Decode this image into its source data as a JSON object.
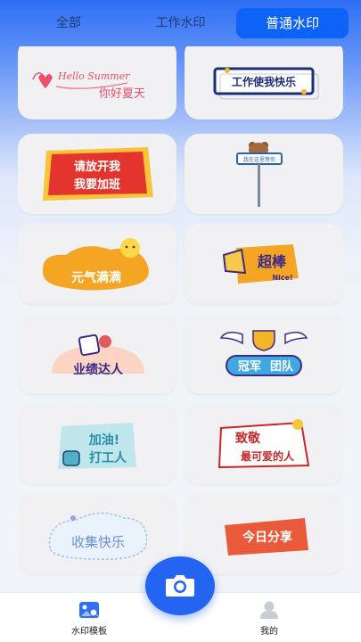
{
  "tabs": [
    {
      "label": "全部"
    },
    {
      "label": "工作水印"
    },
    {
      "label": "普通水印"
    }
  ],
  "active_tab": "普通水印",
  "stickers": [
    {
      "text_1": "Hello Summer",
      "text_2": "你好夏天"
    },
    {
      "text": "工作使我快乐"
    },
    {
      "text_1": "请放开我",
      "text_2": "我要加班"
    },
    {
      "text": "我在这里等你"
    },
    {
      "text": "元气满满"
    },
    {
      "text_1": "超棒",
      "text_2": "Nice!"
    },
    {
      "text": "业绩达人"
    },
    {
      "text_1": "冠军",
      "text_2": "团队"
    },
    {
      "text_1": "加油!",
      "text_2": "打工人"
    },
    {
      "text_1": "致敬",
      "text_2": "最可爱的人"
    },
    {
      "text": "收集快乐"
    },
    {
      "text": "今日分享"
    }
  ],
  "bottom_nav": {
    "items": [
      {
        "label": "水印模板"
      },
      {
        "label": "我的"
      }
    ]
  },
  "icons": {
    "camera": "camera-icon",
    "template": "watermark-template-icon",
    "profile": "person-icon"
  }
}
